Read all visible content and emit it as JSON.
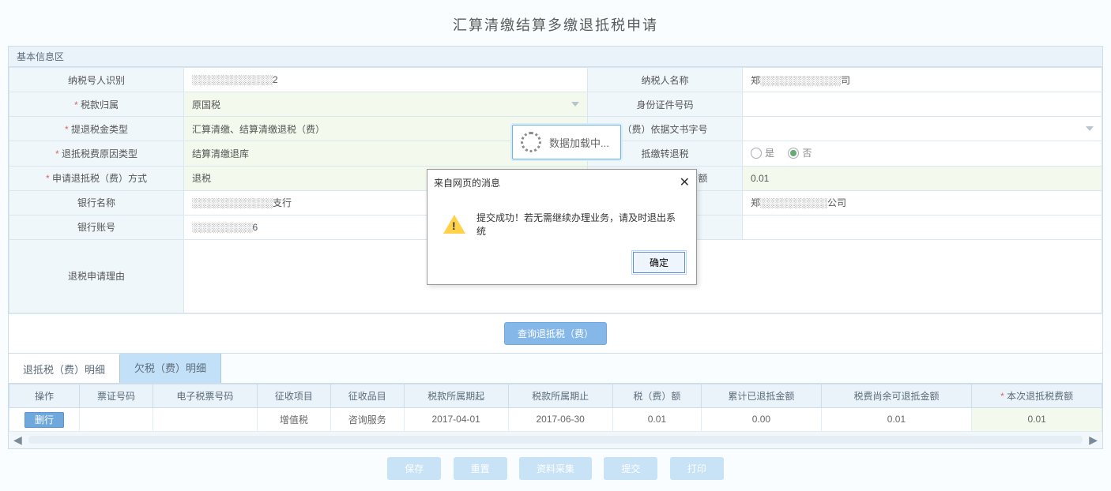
{
  "title": "汇算清缴结算多缴退抵税申请",
  "section": "基本信息区",
  "form": {
    "taxpayer_id_lbl": "纳税号人识别",
    "taxpayer_id_val": "░░░░░░░░░░░░2",
    "taxpayer_name_lbl": "纳税人名称",
    "taxpayer_name_val": "郑░░░░░░░░░░░░司",
    "tax_belong_lbl": "税款归属",
    "tax_belong_val": "原国税",
    "idcard_lbl": "身份证件号码",
    "idcard_val": "",
    "refund_kind_lbl": "提退税金类型",
    "refund_kind_val": "汇算清缴、结算清缴退税（费）",
    "doc_no_lbl": "（费）依据文书字号",
    "doc_no_val": "",
    "reason_lbl": "退抵税费原因类型",
    "reason_val": "结算清缴退库",
    "to_offset_lbl": "抵缴转退税",
    "radio_yes": "是",
    "radio_no": "否",
    "method_lbl": "申请退抵税（费）方式",
    "method_val": "退税",
    "apply_amt_lbl": "申请退抵税（费）额",
    "apply_amt_val": "0.01",
    "bank_name_lbl": "银行名称",
    "bank_name_val": "░░░░░░░░░░░░支行",
    "acct_name_lbl": "",
    "acct_name_val": "郑░░░░░░░░░░公司",
    "bank_acct_lbl": "银行账号",
    "bank_acct_val": "░░░░░░░░░6",
    "reason_text_lbl": "退税申请理由"
  },
  "query_btn": "查询退抵税（费）",
  "tabs": {
    "t1": "退抵税（费）明细",
    "t2": "欠税（费）明细"
  },
  "grid": {
    "headers": [
      "操作",
      "票证号码",
      "电子税票号码",
      "征收项目",
      "征收品目",
      "税款所属期起",
      "税款所属期止",
      "税（费）额",
      "累计已退抵金额",
      "税费尚余可退抵金额",
      "本次退抵税费额"
    ],
    "req_last": "*",
    "row": {
      "op": "删行",
      "cert_no": "",
      "eticket": "",
      "item": "增值税",
      "subitem": "咨询服务",
      "from": "2017-04-01",
      "to": "2017-06-30",
      "amount": "0.01",
      "refunded": "0.00",
      "remain": "0.01",
      "this_time": "0.01"
    }
  },
  "footer": {
    "save": "保存",
    "reset": "重置",
    "collect": "资料采集",
    "submit": "提交",
    "print": "打印"
  },
  "loading": "数据加载中...",
  "dialog": {
    "title": "来自网页的消息",
    "msg": "提交成功！若无需继续办理业务，请及时退出系统",
    "ok": "确定"
  }
}
